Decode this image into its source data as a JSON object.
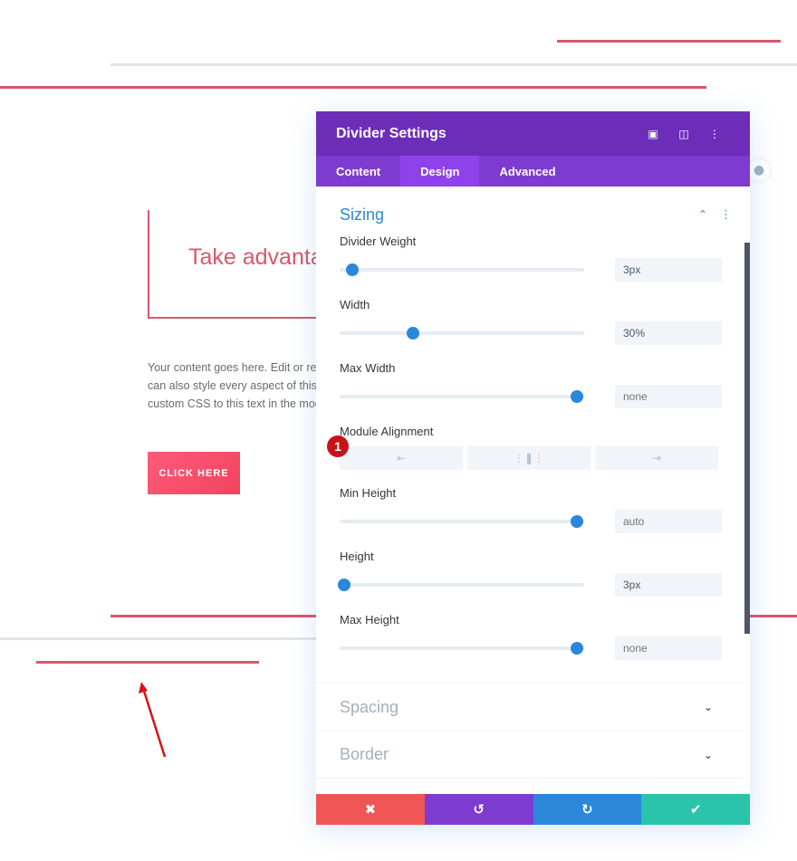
{
  "page": {
    "hero_title": "Take advantage",
    "body_lines": [
      "Your content goes here. Edit or remove",
      "can also style every aspect of this",
      "custom CSS to this text in the module"
    ],
    "cta_label": "CLICK HERE"
  },
  "panel": {
    "title": "Divider Settings",
    "header_icons": [
      "focus-icon",
      "split-view-icon",
      "more-options-icon"
    ],
    "tabs": [
      {
        "label": "Content",
        "active": false
      },
      {
        "label": "Design",
        "active": true
      },
      {
        "label": "Advanced",
        "active": false
      }
    ],
    "sizing": {
      "title": "Sizing",
      "fields": [
        {
          "label": "Divider Weight",
          "value": "3px",
          "slider_fraction": 0.05,
          "placeholder": false
        },
        {
          "label": "Width",
          "value": "30%",
          "slider_fraction": 0.3,
          "placeholder": false
        },
        {
          "label": "Max Width",
          "value": "none",
          "slider_fraction": 0.97,
          "placeholder": true
        },
        {
          "label": "Min Height",
          "value": "auto",
          "slider_fraction": 0.97,
          "placeholder": true
        },
        {
          "label": "Height",
          "value": "3px",
          "slider_fraction": 0.02,
          "placeholder": false
        },
        {
          "label": "Max Height",
          "value": "none",
          "slider_fraction": 0.97,
          "placeholder": true
        }
      ],
      "module_alignment": {
        "label": "Module Alignment",
        "options": [
          "left",
          "center",
          "right"
        ]
      }
    },
    "collapsed_sections": [
      "Spacing",
      "Border"
    ],
    "footer": {
      "cancel_color": "#ef5555",
      "undo_color": "#7e3bd0",
      "redo_color": "#2b87da",
      "save_color": "#29c4a9"
    }
  },
  "annotation": {
    "badge_number": "1"
  },
  "colors": {
    "accent": "#2b87da",
    "header": "#6c2eb9",
    "tabs": "#7e3bd0",
    "divider_red": "#d9576b"
  }
}
